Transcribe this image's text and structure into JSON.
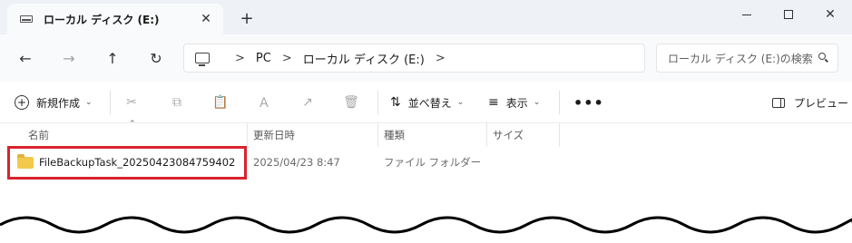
{
  "tab": {
    "title": "ローカル ディスク (E:)",
    "close_glyph": "✕",
    "new_tab_glyph": "+"
  },
  "window": {
    "close_glyph": "✕"
  },
  "nav": {
    "back_glyph": "←",
    "forward_glyph": "→",
    "up_glyph": "↑",
    "refresh_glyph": "↻"
  },
  "address": {
    "separator": ">",
    "crumbs": [
      "PC",
      "ローカル ディスク (E:)"
    ]
  },
  "search": {
    "placeholder": "ローカル ディスク (E:)の検索"
  },
  "toolbar": {
    "new_label": "新規作成",
    "new_glyph": "+",
    "caret_glyph": "⌄",
    "cut_glyph": "✂",
    "copy_glyph": "⧉",
    "paste_glyph": "📋",
    "rename_glyph": "Ａ",
    "share_glyph": "↗",
    "delete_glyph": "🗑",
    "sort_label": "並べ替え",
    "sort_glyph": "⇅",
    "view_label": "表示",
    "view_glyph": "≡",
    "more_glyph": "•••",
    "preview_label": "プレビュー"
  },
  "columns": {
    "name": "名前",
    "modified": "更新日時",
    "type": "種類",
    "size": "サイズ",
    "sort_glyph": "⌃"
  },
  "files": [
    {
      "name": "FileBackupTask_20250423084759402",
      "modified": "2025/04/23 8:47",
      "type": "ファイル フォルダー",
      "icon": "folder-icon"
    }
  ],
  "colors": {
    "highlight": "#d9232e",
    "folder": "#f2c94c",
    "tabbar": "#eef1f5"
  }
}
